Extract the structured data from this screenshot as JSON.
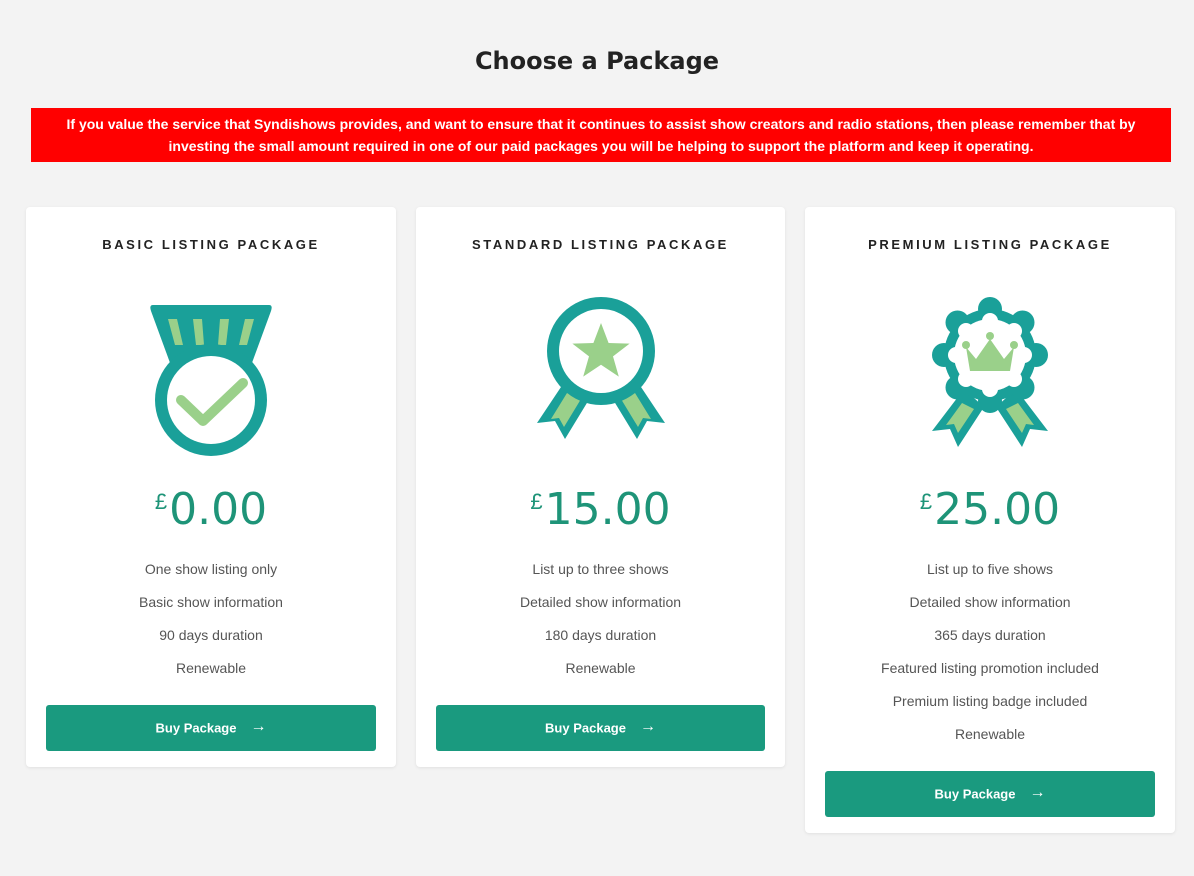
{
  "page": {
    "title": "Choose a Package",
    "notice": "If you value the service that Syndishows provides, and want to ensure that it continues to assist show creators and radio stations, then please remember that by investing the small amount required in one of our paid packages you will be helping to support the platform and keep it operating."
  },
  "colors": {
    "accent": "#1a9a7f",
    "price": "#1e9478",
    "icon_teal": "#1aa099",
    "icon_green": "#9ad08a",
    "notice_bg": "#ff0000"
  },
  "packages": [
    {
      "title": "BASIC LISTING PACKAGE",
      "icon": "medal-check-icon",
      "currency": "£",
      "price": "0.00",
      "features": [
        "One show listing only",
        "Basic show information",
        "90 days duration",
        "Renewable"
      ],
      "button_label": "Buy Package",
      "button_icon": "arrow-right-icon"
    },
    {
      "title": "STANDARD LISTING PACKAGE",
      "icon": "award-star-icon",
      "currency": "£",
      "price": "15.00",
      "features": [
        "List up to three shows",
        "Detailed show information",
        "180 days duration",
        "Renewable"
      ],
      "button_label": "Buy Package",
      "button_icon": "arrow-right-icon"
    },
    {
      "title": "PREMIUM LISTING PACKAGE",
      "icon": "award-crown-icon",
      "currency": "£",
      "price": "25.00",
      "features": [
        "List up to five shows",
        "Detailed show information",
        "365 days duration",
        "Featured listing promotion included",
        "Premium listing badge included",
        "Renewable"
      ],
      "button_label": "Buy Package",
      "button_icon": "arrow-right-icon"
    }
  ]
}
